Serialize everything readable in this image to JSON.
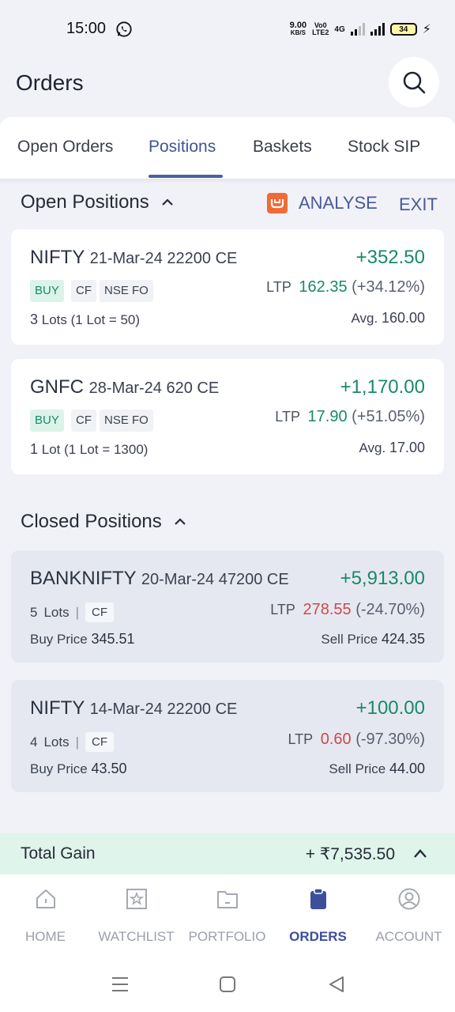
{
  "status_bar": {
    "time": "15:00",
    "net_speed": "9.00",
    "net_unit": "KB/S",
    "volte_top": "Vo0",
    "volte_bottom": "LTE2",
    "network": "4G",
    "battery": "34"
  },
  "header": {
    "title": "Orders"
  },
  "tabs": [
    {
      "label": "Open Orders"
    },
    {
      "label": "Positions"
    },
    {
      "label": "Baskets"
    },
    {
      "label": "Stock SIP"
    }
  ],
  "open_positions": {
    "title": "Open Positions",
    "analyse_label": "ANALYSE",
    "exit_label": "EXIT",
    "items": [
      {
        "symbol": "NIFTY",
        "contract": "21-Mar-24 22200 CE",
        "pnl": "+352.50",
        "side": "BUY",
        "product": "CF",
        "exchange": "NSE FO",
        "ltp_label": "LTP",
        "ltp": "162.35",
        "change": "(+34.12%)",
        "lots_count": "3",
        "lots_word": "Lots",
        "lot_size": "(1 Lot = 50)",
        "avg_label": "Avg.",
        "avg": "160.00"
      },
      {
        "symbol": "GNFC",
        "contract": "28-Mar-24 620 CE",
        "pnl": "+1,170.00",
        "side": "BUY",
        "product": "CF",
        "exchange": "NSE FO",
        "ltp_label": "LTP",
        "ltp": "17.90",
        "change": "(+51.05%)",
        "lots_count": "1",
        "lots_word": "Lot",
        "lot_size": "(1 Lot = 1300)",
        "avg_label": "Avg.",
        "avg": "17.00"
      }
    ]
  },
  "closed_positions": {
    "title": "Closed Positions",
    "items": [
      {
        "symbol": "BANKNIFTY",
        "contract": "20-Mar-24 47200 CE",
        "pnl": "+5,913.00",
        "lots_count": "5",
        "lots_word": "Lots",
        "product": "CF",
        "ltp_label": "LTP",
        "ltp": "278.55",
        "change": "(-24.70%)",
        "buy_label": "Buy Price",
        "buy_price": "345.51",
        "sell_label": "Sell Price",
        "sell_price": "424.35"
      },
      {
        "symbol": "NIFTY",
        "contract": "14-Mar-24 22200 CE",
        "pnl": "+100.00",
        "lots_count": "4",
        "lots_word": "Lots",
        "product": "CF",
        "ltp_label": "LTP",
        "ltp": "0.60",
        "change": "(-97.30%)",
        "buy_label": "Buy Price",
        "buy_price": "43.50",
        "sell_label": "Sell Price",
        "sell_price": "44.00"
      }
    ]
  },
  "total_gain": {
    "label": "Total Gain",
    "value": "+ ₹7,535.50"
  },
  "bottom_nav": [
    {
      "label": "HOME",
      "icon": "home-icon"
    },
    {
      "label": "WATCHLIST",
      "icon": "star-icon"
    },
    {
      "label": "PORTFOLIO",
      "icon": "folder-icon"
    },
    {
      "label": "ORDERS",
      "icon": "clipboard-icon",
      "active": true
    },
    {
      "label": "ACCOUNT",
      "icon": "account-icon"
    }
  ],
  "colors": {
    "accent": "#3d4f9a",
    "profit": "#18896a",
    "loss": "#cc4a48",
    "analyse_icon": "#f26a36"
  }
}
